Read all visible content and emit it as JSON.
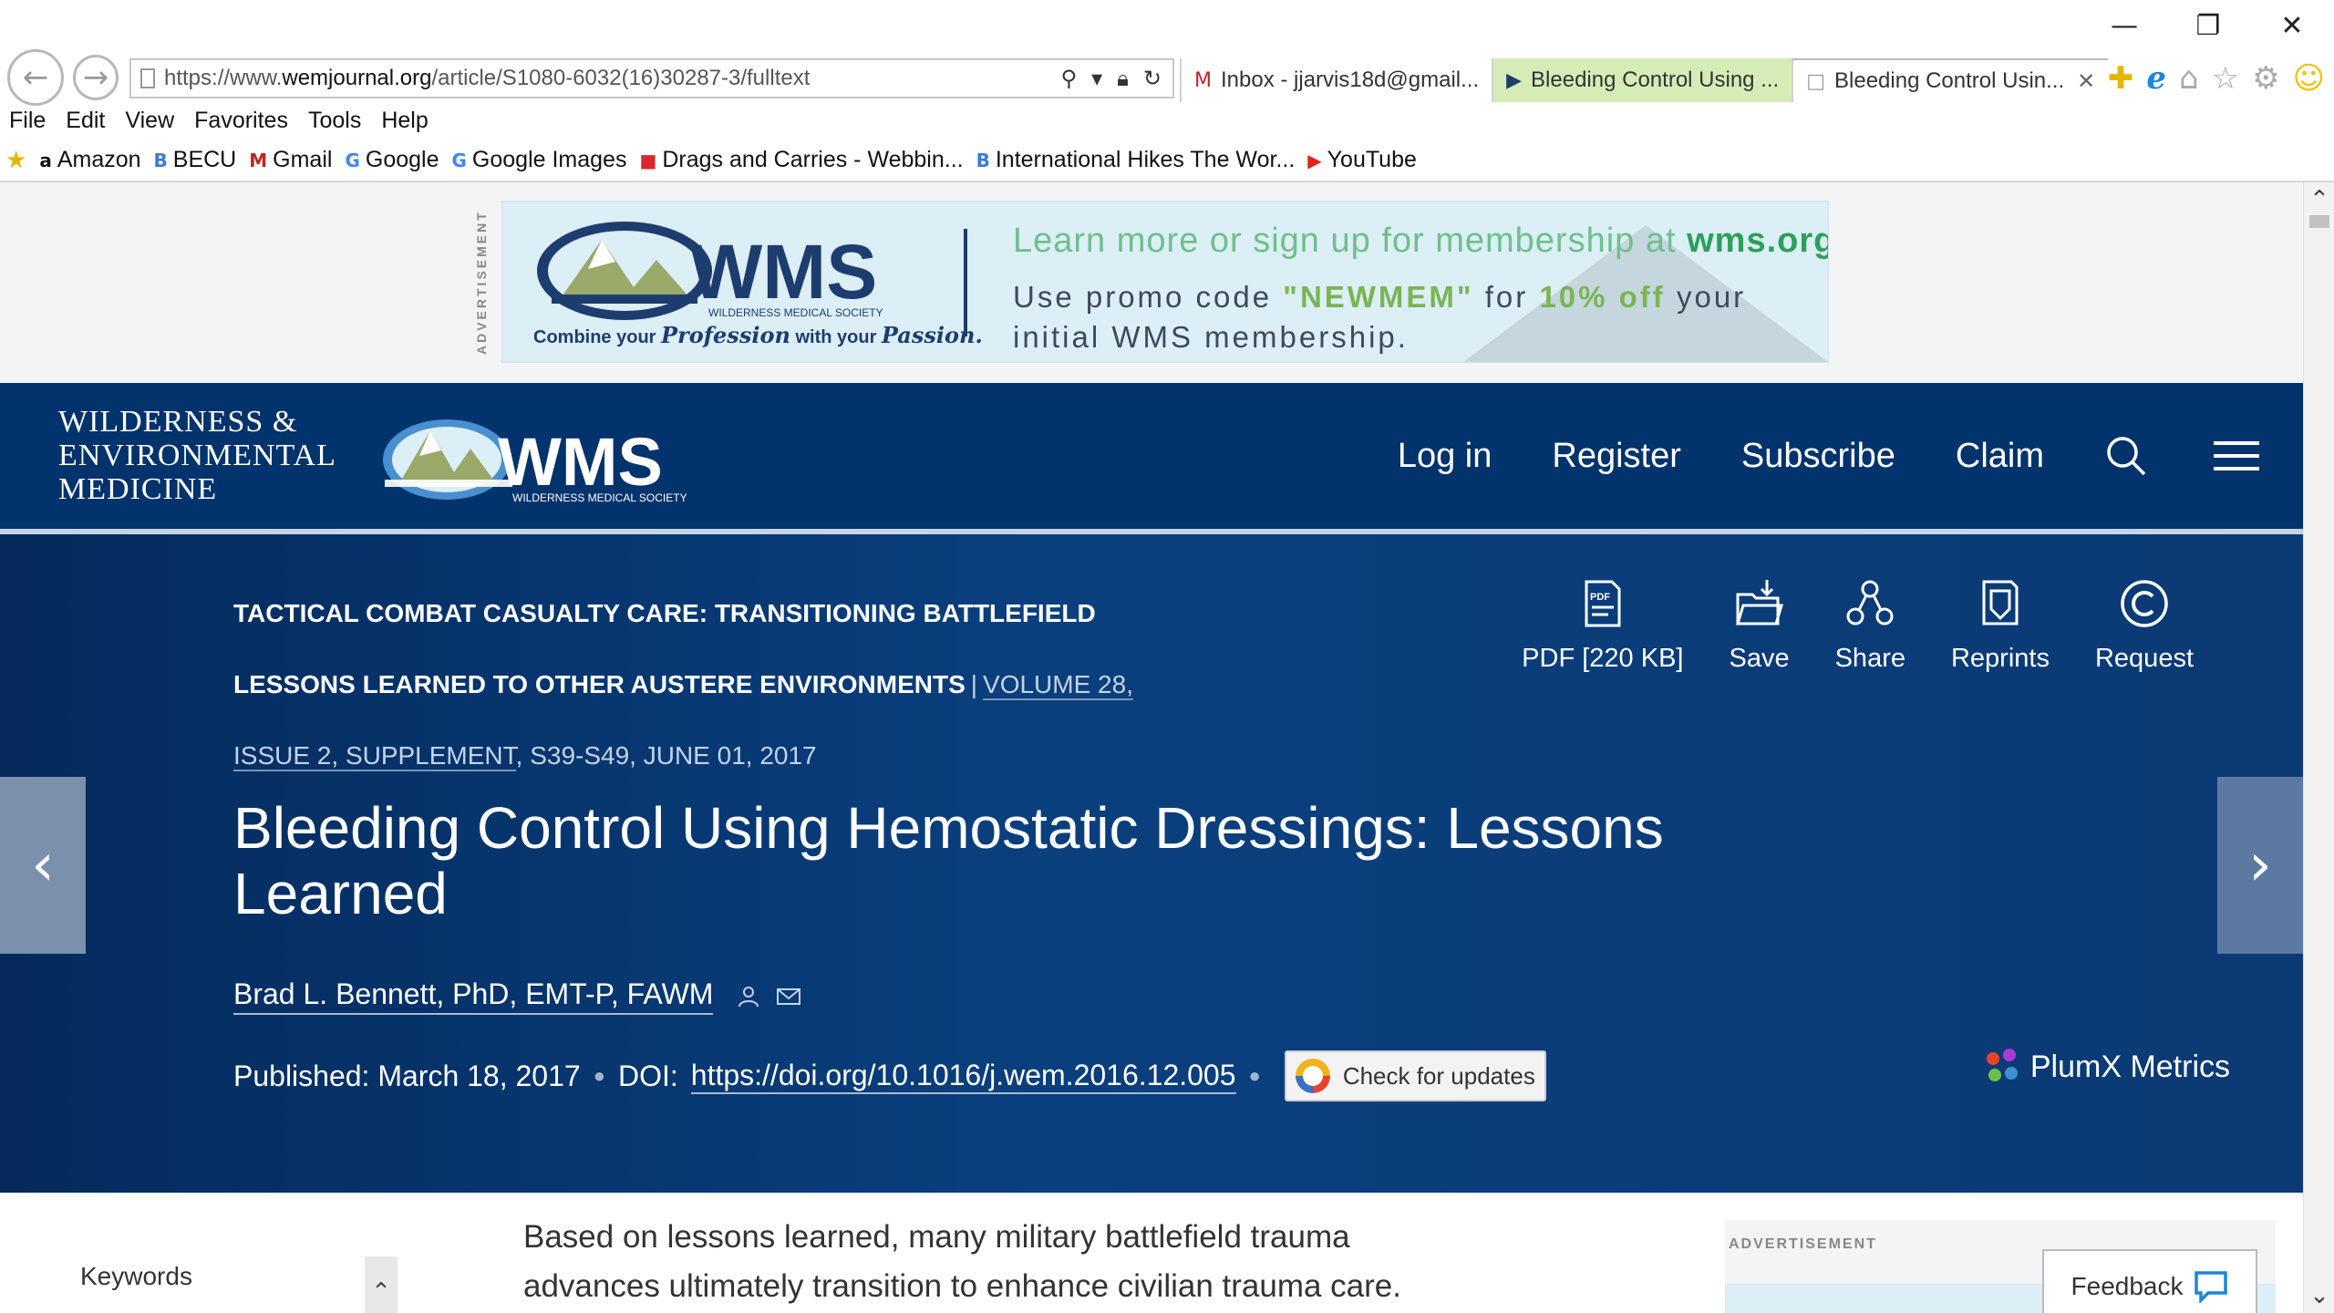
{
  "browser": {
    "url_prefix": "https://www.",
    "url_host": "wemjournal.org",
    "url_path": "/article/S1080-6032(16)30287-3/fulltext",
    "tabs": [
      {
        "icon": "M",
        "label": "Inbox - jjarvis18d@gmail..."
      },
      {
        "icon": "▶",
        "label": "Bleeding Control Using ..."
      },
      {
        "icon": "□",
        "label": "Bleeding Control Usin..."
      }
    ],
    "menu": [
      "File",
      "Edit",
      "View",
      "Favorites",
      "Tools",
      "Help"
    ],
    "favorites": [
      {
        "icon": "a",
        "label": "Amazon"
      },
      {
        "icon": "B",
        "label": "BECU"
      },
      {
        "icon": "M",
        "label": "Gmail"
      },
      {
        "icon": "G",
        "label": "Google"
      },
      {
        "icon": "G",
        "label": "Google Images"
      },
      {
        "icon": "■",
        "label": "Drags and Carries - Webbin..."
      },
      {
        "icon": "B",
        "label": "International Hikes The Wor..."
      },
      {
        "icon": "▶",
        "label": "YouTube"
      }
    ]
  },
  "ad_top": {
    "label": "ADVERTISEMENT",
    "logo_text": "WMS",
    "logo_sub": "WILDERNESS MEDICAL SOCIETY",
    "tagline_a": "Combine your ",
    "tagline_b": "Profession",
    "tagline_c": " with your ",
    "tagline_d": "Passion.",
    "line1_a": "Learn more or sign up for membership at ",
    "line1_b": "wms.org",
    "line2_a": "Use promo code ",
    "line2_b": "\"NEWMEM\"",
    "line2_c": " for ",
    "line2_d": "10% off",
    "line2_e": " your",
    "line3": "initial WMS membership."
  },
  "header": {
    "journal_line1": "WILDERNESS &",
    "journal_line2": "ENVIRONMENTAL",
    "journal_line3": "MEDICINE",
    "logo_text": "WMS",
    "logo_sub": "WILDERNESS MEDICAL SOCIETY",
    "nav": [
      "Log in",
      "Register",
      "Subscribe",
      "Claim"
    ]
  },
  "article": {
    "section_line1": "TACTICAL COMBAT CASUALTY CARE: TRANSITIONING BATTLEFIELD",
    "section_line2": "LESSONS LEARNED TO OTHER AUSTERE ENVIRONMENTS",
    "volume": "VOLUME 28,",
    "issue": "ISSUE 2, SUPPLEMENT",
    "pages_date": ", S39-S49, JUNE 01, 2017",
    "title": "Bleeding Control Using Hemostatic Dressings: Lessons Learned",
    "author": "Brad L. Bennett, PhD, EMT-P, FAWM",
    "published": "Published: March 18, 2017",
    "doi_label": "DOI:",
    "doi_link": "https://doi.org/10.1016/j.wem.2016.12.005",
    "check_updates": "Check for updates",
    "plumx": "PlumX Metrics",
    "actions": [
      "PDF [220 KB]",
      "Save",
      "Share",
      "Reprints",
      "Request"
    ]
  },
  "body": {
    "keywords_label": "Keywords",
    "text_line1": "Based on lessons learned, many military battlefield trauma",
    "text_line2": "advances ultimately transition to enhance civilian trauma care.",
    "side_ad_label": "ADVERTISEMENT",
    "feedback": "Feedback"
  }
}
